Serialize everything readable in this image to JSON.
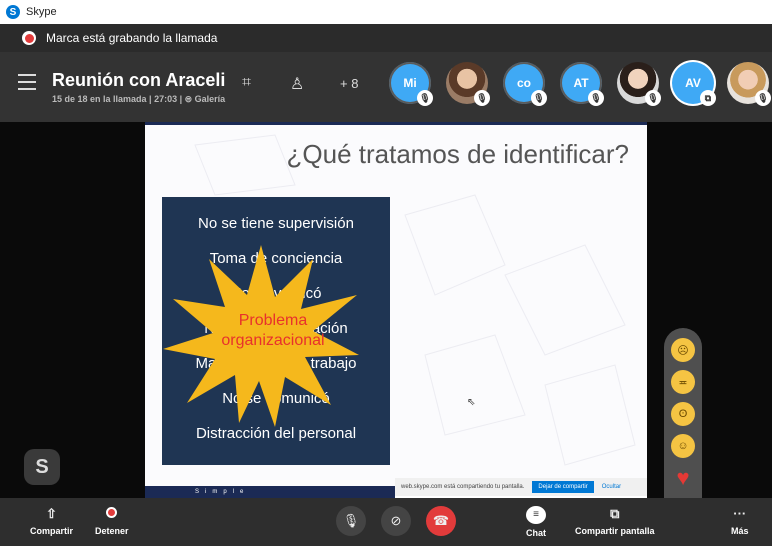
{
  "window": {
    "app_title": "Skype",
    "logo_letter": "S"
  },
  "recording": {
    "text": "Marca está grabando la llamada"
  },
  "header": {
    "title": "Reunión con Araceli",
    "subtitle": "15 de 18 en la llamada | 27:03 | ⊜ Galería",
    "extra_participants": "+ 8",
    "participants": [
      {
        "label": "Mi",
        "muted": true
      },
      {
        "label": "",
        "muted": true
      },
      {
        "label": "co",
        "muted": true
      },
      {
        "label": "AT",
        "muted": true
      },
      {
        "label": "",
        "muted": true
      },
      {
        "label": "AV",
        "muted": false
      },
      {
        "label": "",
        "muted": true
      }
    ]
  },
  "slide": {
    "title": "¿Qué tratamos de identificar?",
    "box_lines": [
      "No se tiene supervisión",
      "Toma de conciencia",
      "No se verificó",
      "No hay comunicación",
      "Mal ambiente de trabajo",
      "No se comunicó",
      "Distracción del personal"
    ],
    "burst_text": "Problema organizacional",
    "footer_brand": "Simple",
    "share_notice": "web.skype.com está compartiendo tu pantalla.",
    "share_stop": "Dejar de compartir",
    "share_hide": "Ocultar"
  },
  "fab": {
    "letter": "S"
  },
  "reactions": [
    "sad-emoji",
    "laughing-emoji",
    "surprised-emoji",
    "smile-emoji",
    "heart-emoji",
    "clap-emoji"
  ],
  "toolbar": {
    "share_label": "Compartir",
    "stop_label": "Detener",
    "chat_label": "Chat",
    "screen_share_label": "Compartir pantalla",
    "more_label": "Más"
  },
  "colors": {
    "accent": "#0078d4",
    "record": "#e23b3b",
    "slide_box": "#1f3553",
    "burst": "#f5b81c"
  }
}
